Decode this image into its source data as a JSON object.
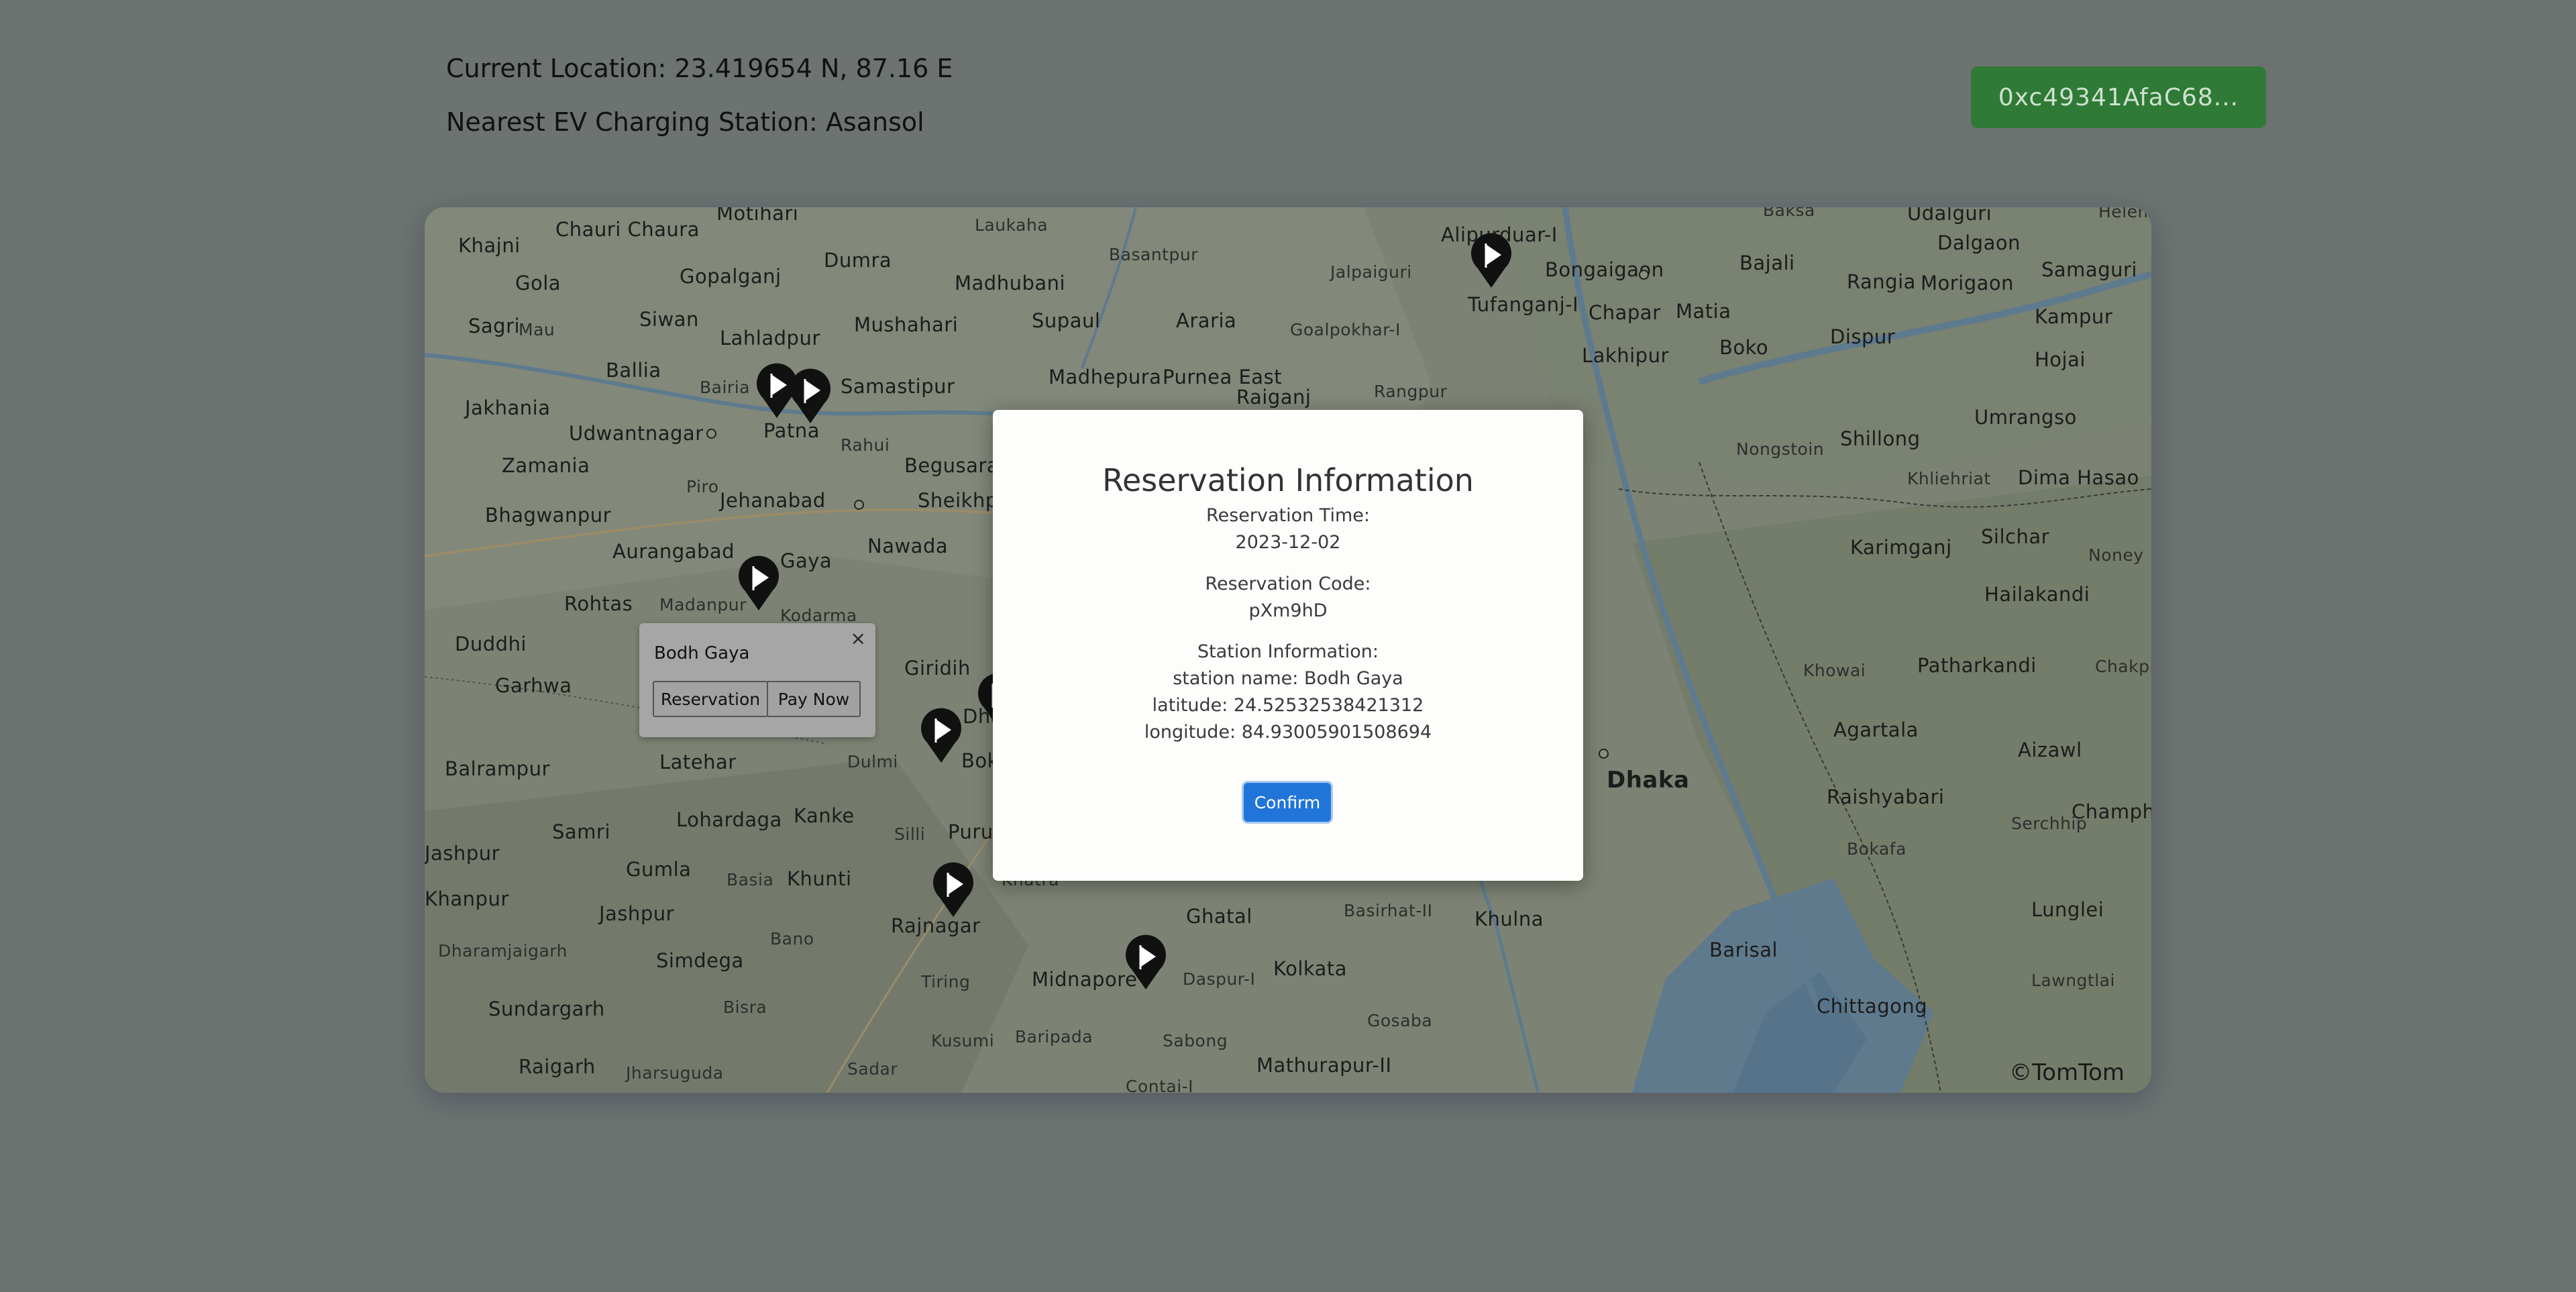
{
  "header": {
    "current_location": "Current Location: 23.419654 N, 87.16 E",
    "nearest_station": "Nearest EV Charging Station: Asansol"
  },
  "wallet": {
    "address_short": "0xc49341AfaC68..."
  },
  "map": {
    "attribution": "©TomTom",
    "places": [
      {
        "name": "Khajni"
      },
      {
        "name": "Chauri Chaura"
      },
      {
        "name": "Motihari"
      },
      {
        "name": "Laukaha"
      },
      {
        "name": "Dumra"
      },
      {
        "name": "Madhubani"
      },
      {
        "name": "Basantpur"
      },
      {
        "name": "Jalpaiguri"
      },
      {
        "name": "Gola"
      },
      {
        "name": "Gopalganj"
      },
      {
        "name": "Supaul"
      },
      {
        "name": "Araria"
      },
      {
        "name": "Mushahari"
      },
      {
        "name": "Alipurduar-I"
      },
      {
        "name": "Bongaigaon"
      },
      {
        "name": "Bajali"
      },
      {
        "name": "Rangia"
      },
      {
        "name": "Udalguri"
      },
      {
        "name": "Dalgaon"
      },
      {
        "name": "Samaguri"
      },
      {
        "name": "Morigaon"
      },
      {
        "name": "Kampur"
      },
      {
        "name": "Hojai"
      },
      {
        "name": "Sagri"
      },
      {
        "name": "Mau"
      },
      {
        "name": "Siwan"
      },
      {
        "name": "Lahladpur"
      },
      {
        "name": "Goalpokhar-I"
      },
      {
        "name": "Tufanganj-I"
      },
      {
        "name": "Chapar"
      },
      {
        "name": "Matia"
      },
      {
        "name": "Boko"
      },
      {
        "name": "Dispur"
      },
      {
        "name": "Lakhipur"
      },
      {
        "name": "Ballia"
      },
      {
        "name": "Bairia"
      },
      {
        "name": "Samastipur"
      },
      {
        "name": "Madhepura"
      },
      {
        "name": "Purnea East"
      },
      {
        "name": "Raiganj"
      },
      {
        "name": "Rangpur"
      },
      {
        "name": "Jakhania"
      },
      {
        "name": "Patna"
      },
      {
        "name": "Rahui"
      },
      {
        "name": "Udwantnagar"
      },
      {
        "name": "Zamania"
      },
      {
        "name": "Begusarai"
      },
      {
        "name": "Nongstoin"
      },
      {
        "name": "Shillong"
      },
      {
        "name": "Umrangso"
      },
      {
        "name": "Piro"
      },
      {
        "name": "Jehanabad"
      },
      {
        "name": "Sheikhpura"
      },
      {
        "name": "Khliehriat"
      },
      {
        "name": "Dima Hasao"
      },
      {
        "name": "Bhagwanpur"
      },
      {
        "name": "Aurangabad"
      },
      {
        "name": "Gaya"
      },
      {
        "name": "Nawada"
      },
      {
        "name": "Karimganj"
      },
      {
        "name": "Silchar"
      },
      {
        "name": "Noney"
      },
      {
        "name": "Rohtas"
      },
      {
        "name": "Madanpur"
      },
      {
        "name": "Kodarma"
      },
      {
        "name": "Hailakandi"
      },
      {
        "name": "Duddhi"
      },
      {
        "name": "Giridih"
      },
      {
        "name": "Khowai"
      },
      {
        "name": "Patharkandi"
      },
      {
        "name": "Chakpikar"
      },
      {
        "name": "Garhwa"
      },
      {
        "name": "Agartala"
      },
      {
        "name": "Aizawl"
      },
      {
        "name": "Balrampur"
      },
      {
        "name": "Latehar"
      },
      {
        "name": "Dulmi"
      },
      {
        "name": "Dhaka"
      },
      {
        "name": "Raishyabari"
      },
      {
        "name": "Champhai"
      },
      {
        "name": "Lohardaga"
      },
      {
        "name": "Kanke"
      },
      {
        "name": "Serchhip"
      },
      {
        "name": "Bokafa"
      },
      {
        "name": "Samri"
      },
      {
        "name": "Silli"
      },
      {
        "name": "Purulia"
      },
      {
        "name": "Gumla"
      },
      {
        "name": "Basia"
      },
      {
        "name": "Khunti"
      },
      {
        "name": "Lunglei"
      },
      {
        "name": "Jashpur"
      },
      {
        "name": "Bano"
      },
      {
        "name": "Rajnagar"
      },
      {
        "name": "Ghatal"
      },
      {
        "name": "Basirhat-II"
      },
      {
        "name": "Khulna"
      },
      {
        "name": "Lawngtlai"
      },
      {
        "name": "Dharamjaigarh"
      },
      {
        "name": "Simdega"
      },
      {
        "name": "Barisal"
      },
      {
        "name": "Tiring"
      },
      {
        "name": "Midnapore"
      },
      {
        "name": "Daspur-I"
      },
      {
        "name": "Kolkata"
      },
      {
        "name": "Sundargarh"
      },
      {
        "name": "Bisra"
      },
      {
        "name": "Kusumi"
      },
      {
        "name": "Baripada"
      },
      {
        "name": "Sabong"
      },
      {
        "name": "Gosaba"
      },
      {
        "name": "Chittagong"
      },
      {
        "name": "Raigarh"
      },
      {
        "name": "Jharsuguda"
      },
      {
        "name": "Sadar"
      },
      {
        "name": "Mathurapur-II"
      },
      {
        "name": "Contai-I"
      },
      {
        "name": "Khatra"
      },
      {
        "name": "Bokaro"
      },
      {
        "name": "Dhanbad"
      },
      {
        "name": "Baksa"
      },
      {
        "name": "Helem"
      },
      {
        "name": "Khanpur"
      },
      {
        "name": "Jashpur"
      }
    ]
  },
  "popup": {
    "title": "Bodh Gaya",
    "close": "×",
    "reservation_label": "Reservation",
    "pay_label": "Pay Now"
  },
  "modal": {
    "title": "Reservation Information",
    "time_label": "Reservation Time:",
    "time_value": "2023-12-02",
    "code_label": "Reservation Code:",
    "code_value": "pXm9hD",
    "station_label": "Station Information:",
    "station_name": "station name: Bodh Gaya",
    "latitude": "latitude: 24.52532538421312",
    "longitude": "longitude: 84.93005901508694",
    "confirm_label": "Confirm"
  }
}
